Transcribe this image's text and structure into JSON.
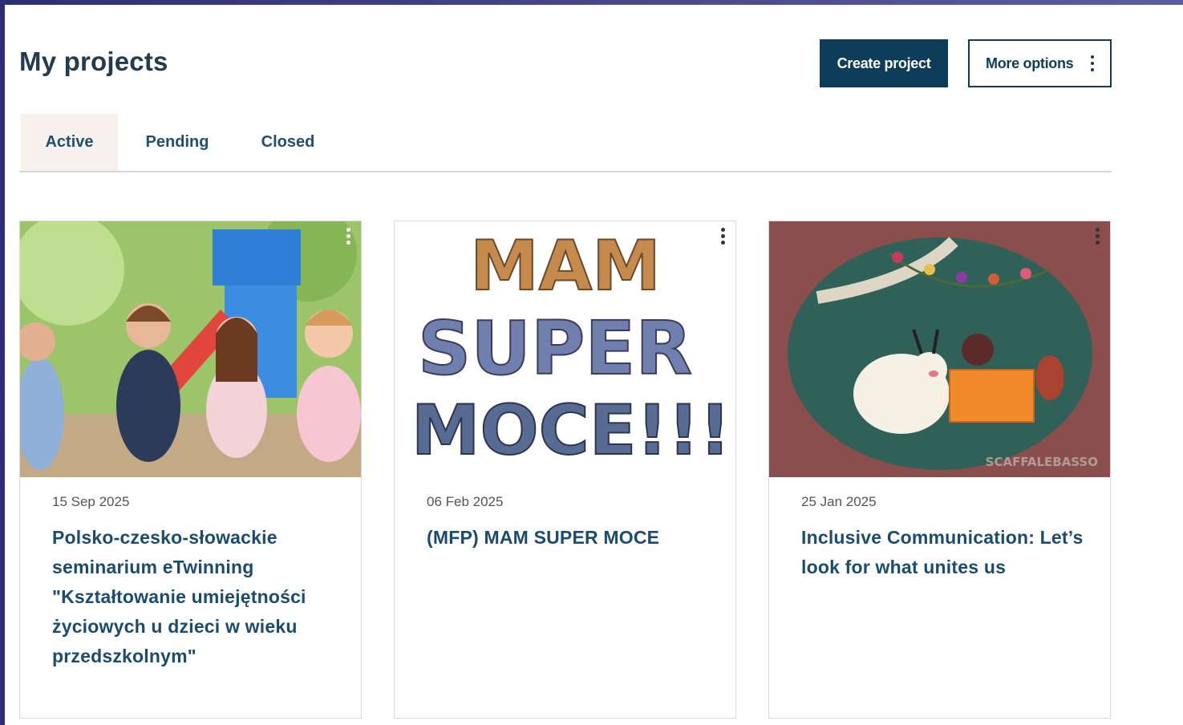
{
  "page": {
    "title": "My projects"
  },
  "toolbar": {
    "create_label": "Create project",
    "more_label": "More options"
  },
  "tabs": [
    {
      "label": "Active",
      "selected": true
    },
    {
      "label": "Pending",
      "selected": false
    },
    {
      "label": "Closed",
      "selected": false
    }
  ],
  "projects": [
    {
      "date": "15 Sep 2025",
      "title": "Polsko-czesko-słowackie seminarium eTwinning \"Kształtowanie umiejętności życiowych u dzieci w wieku przedszkolnym\"",
      "image": "children-playground-photo"
    },
    {
      "date": "06 Feb 2025",
      "title": "(MFP) MAM SUPER MOCE",
      "image": "mam-super-moce-letters-photo",
      "image_text": [
        "MAM",
        "SUPER",
        "MOCE!!!"
      ]
    },
    {
      "date": "25 Jan 2025",
      "title": "Inclusive Communication: Let’s look for what unites us",
      "image": "felt-sheep-illustration",
      "image_watermark": "SCAFFALEBASSO"
    }
  ],
  "colors": {
    "frame": "#2e2f72",
    "primary": "#0d3d58",
    "title_text": "#243a4f",
    "link_text": "#1b4b6d",
    "active_tab_bg": "#f6f1ec"
  }
}
